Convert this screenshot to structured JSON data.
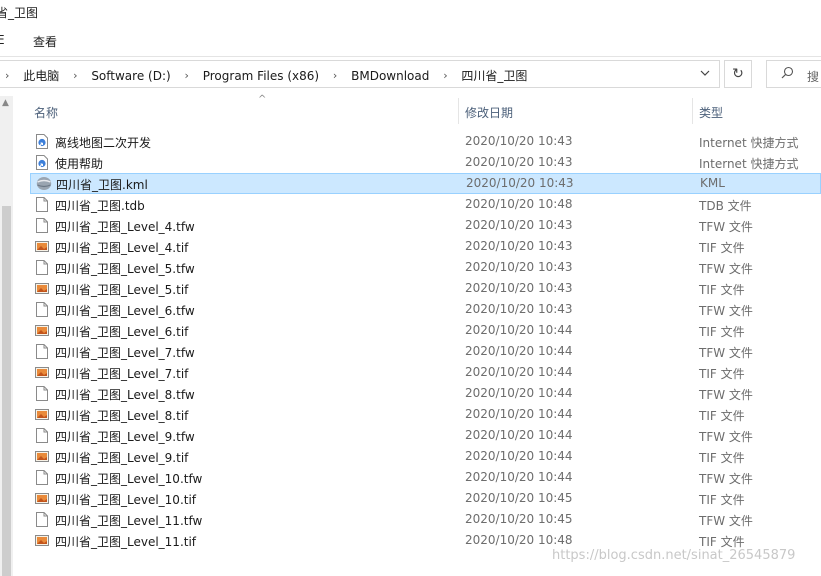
{
  "window": {
    "title": "省_卫图"
  },
  "ribbon": {
    "file_tab": "E",
    "view_tab": "查看"
  },
  "address": {
    "crumbs": [
      "此电脑",
      "Software (D:)",
      "Program Files (x86)",
      "BMDownload",
      "四川省_卫图"
    ],
    "separator": "›"
  },
  "search": {
    "placeholder": "搜"
  },
  "columns": {
    "name": "名称",
    "date": "修改日期",
    "type": "类型"
  },
  "colors": {
    "selected_bg": "#cce8ff",
    "selected_border": "#99d1ff",
    "header_text": "#4c607a"
  },
  "files": [
    {
      "name": "离线地图二次开发",
      "date": "2020/10/20 10:43",
      "type": "Internet 快捷方式",
      "icon": "internet-shortcut-icon"
    },
    {
      "name": "使用帮助",
      "date": "2020/10/20 10:43",
      "type": "Internet 快捷方式",
      "icon": "internet-shortcut-icon"
    },
    {
      "name": "四川省_卫图.kml",
      "date": "2020/10/20 10:43",
      "type": "KML",
      "icon": "kml-file-icon",
      "selected": true
    },
    {
      "name": "四川省_卫图.tdb",
      "date": "2020/10/20 10:48",
      "type": "TDB 文件",
      "icon": "blank-file-icon"
    },
    {
      "name": "四川省_卫图_Level_4.tfw",
      "date": "2020/10/20 10:43",
      "type": "TFW 文件",
      "icon": "blank-file-icon"
    },
    {
      "name": "四川省_卫图_Level_4.tif",
      "date": "2020/10/20 10:43",
      "type": "TIF 文件",
      "icon": "image-file-icon"
    },
    {
      "name": "四川省_卫图_Level_5.tfw",
      "date": "2020/10/20 10:43",
      "type": "TFW 文件",
      "icon": "blank-file-icon"
    },
    {
      "name": "四川省_卫图_Level_5.tif",
      "date": "2020/10/20 10:43",
      "type": "TIF 文件",
      "icon": "image-file-icon"
    },
    {
      "name": "四川省_卫图_Level_6.tfw",
      "date": "2020/10/20 10:43",
      "type": "TFW 文件",
      "icon": "blank-file-icon"
    },
    {
      "name": "四川省_卫图_Level_6.tif",
      "date": "2020/10/20 10:44",
      "type": "TIF 文件",
      "icon": "image-file-icon"
    },
    {
      "name": "四川省_卫图_Level_7.tfw",
      "date": "2020/10/20 10:44",
      "type": "TFW 文件",
      "icon": "blank-file-icon"
    },
    {
      "name": "四川省_卫图_Level_7.tif",
      "date": "2020/10/20 10:44",
      "type": "TIF 文件",
      "icon": "image-file-icon"
    },
    {
      "name": "四川省_卫图_Level_8.tfw",
      "date": "2020/10/20 10:44",
      "type": "TFW 文件",
      "icon": "blank-file-icon"
    },
    {
      "name": "四川省_卫图_Level_8.tif",
      "date": "2020/10/20 10:44",
      "type": "TIF 文件",
      "icon": "image-file-icon"
    },
    {
      "name": "四川省_卫图_Level_9.tfw",
      "date": "2020/10/20 10:44",
      "type": "TFW 文件",
      "icon": "blank-file-icon"
    },
    {
      "name": "四川省_卫图_Level_9.tif",
      "date": "2020/10/20 10:44",
      "type": "TIF 文件",
      "icon": "image-file-icon"
    },
    {
      "name": "四川省_卫图_Level_10.tfw",
      "date": "2020/10/20 10:44",
      "type": "TFW 文件",
      "icon": "blank-file-icon"
    },
    {
      "name": "四川省_卫图_Level_10.tif",
      "date": "2020/10/20 10:45",
      "type": "TIF 文件",
      "icon": "image-file-icon"
    },
    {
      "name": "四川省_卫图_Level_11.tfw",
      "date": "2020/10/20 10:45",
      "type": "TFW 文件",
      "icon": "blank-file-icon"
    },
    {
      "name": "四川省_卫图_Level_11.tif",
      "date": "2020/10/20 10:48",
      "type": "TIF 文件",
      "icon": "image-file-icon"
    }
  ],
  "watermark": "https://blog.csdn.net/sinat_26545879"
}
